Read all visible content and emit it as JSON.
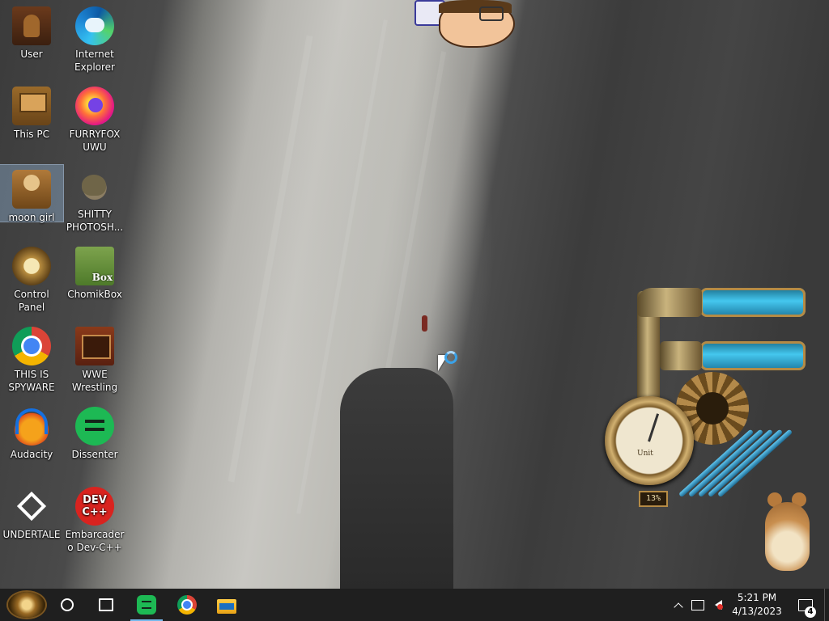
{
  "desktop": {
    "icons": [
      {
        "label": "User",
        "icon": "user-folder-icon"
      },
      {
        "label": "Internet Explorer",
        "icon": "edge-icon"
      },
      {
        "label": "This PC",
        "icon": "computer-icon"
      },
      {
        "label": "FURRYFOX UWU",
        "icon": "firefox-icon"
      },
      {
        "label": "moon girl",
        "icon": "folder-icon",
        "selected": true
      },
      {
        "label": "SHITTY PHOTOSH...",
        "icon": "gimp-icon"
      },
      {
        "label": "Control Panel",
        "icon": "control-panel-icon"
      },
      {
        "label": "ChomikBox",
        "icon": "chomikbox-icon"
      },
      {
        "label": "THIS IS SPYWARE",
        "icon": "chrome-icon"
      },
      {
        "label": "WWE Wrestling",
        "icon": "game-icon"
      },
      {
        "label": "Audacity",
        "icon": "audacity-icon"
      },
      {
        "label": "Dissenter",
        "icon": "dissenter-icon"
      },
      {
        "label": "UNDERTALE",
        "icon": "unity-icon"
      },
      {
        "label": "Embarcadero Dev-C++",
        "icon": "devcpp-icon"
      }
    ],
    "devcpp_logo_text": "DEV C++",
    "chomikbox_logo_text": "Box"
  },
  "gadgets": {
    "cpu_meter": {
      "gauge_label": "Unit",
      "percent_text": "13%",
      "percent_value": 13
    }
  },
  "taskbar": {
    "start": "start-button",
    "pinned": [
      {
        "name": "dissenter",
        "icon": "dissenter-icon",
        "running": true
      },
      {
        "name": "chrome",
        "icon": "chrome-icon",
        "running": false
      },
      {
        "name": "file-explorer",
        "icon": "folder-icon",
        "running": false
      }
    ],
    "clock": {
      "time": "5:21 PM",
      "date": "4/13/2023"
    },
    "notifications_count": "4",
    "colors": {
      "taskbar": "#1f1f1f",
      "running_indicator": "#76b9ed",
      "volume_muted": "#e0302a"
    }
  }
}
